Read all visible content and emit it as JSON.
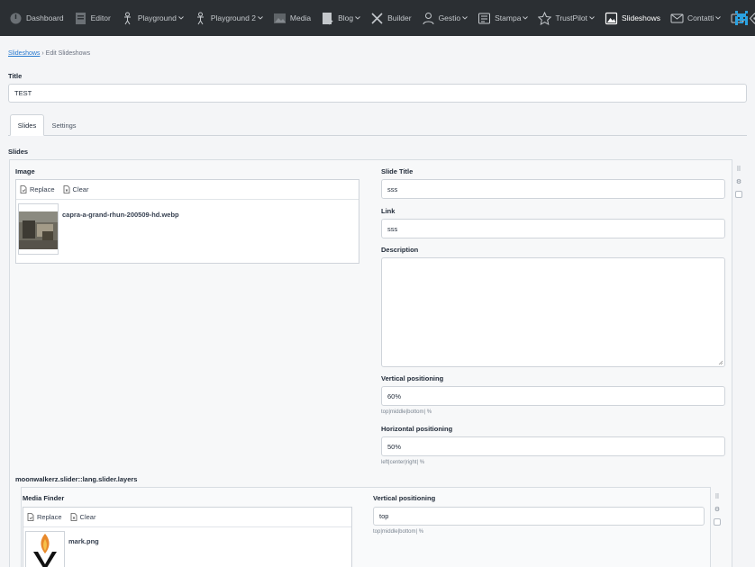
{
  "nav": {
    "items": [
      {
        "label": "Dashboard",
        "icon": "dashboard-icon",
        "has_menu": false
      },
      {
        "label": "Editor",
        "icon": "editor-icon",
        "has_menu": false
      },
      {
        "label": "Playground",
        "icon": "person-icon",
        "has_menu": true
      },
      {
        "label": "Playground 2",
        "icon": "person-icon",
        "has_menu": true
      },
      {
        "label": "Media",
        "icon": "media-icon",
        "has_menu": false
      },
      {
        "label": "Blog",
        "icon": "blog-icon",
        "has_menu": true
      },
      {
        "label": "Builder",
        "icon": "tools-icon",
        "has_menu": false
      },
      {
        "label": "Gestio",
        "icon": "user-icon",
        "has_menu": true
      },
      {
        "label": "Stampa",
        "icon": "newspaper-icon",
        "has_menu": true
      },
      {
        "label": "TrustPilot",
        "icon": "star-icon",
        "has_menu": true
      },
      {
        "label": "Slideshows",
        "icon": "image-icon",
        "has_menu": false,
        "active": true
      },
      {
        "label": "Contatti",
        "icon": "mail-icon",
        "has_menu": true
      }
    ]
  },
  "breadcrumb": {
    "parent": "Slideshows",
    "separator": "›",
    "current": "Edit Slideshows"
  },
  "form": {
    "title_label": "Title",
    "title_value": "TEST",
    "tabs": [
      "Slides",
      "Settings"
    ],
    "slides_label": "Slides"
  },
  "slide": {
    "image_label": "Image",
    "replace_label": "Replace",
    "clear_label": "Clear",
    "file_name": "capra-a-grand-rhun-200509-hd.webp",
    "slide_title_label": "Slide Title",
    "slide_title_value": "sss",
    "link_label": "Link",
    "link_value": "sss",
    "description_label": "Description",
    "description_value": "",
    "vertical_label": "Vertical positioning",
    "vertical_value": "60%",
    "vertical_hint": "top|middle|bottom| %",
    "horizontal_label": "Horizontal positioning",
    "horizontal_value": "50%",
    "horizontal_hint": "left|center|right| %",
    "layers_label": "moonwalkerz.slider::lang.slider.layers"
  },
  "layer": {
    "media_finder_label": "Media Finder",
    "replace_label": "Replace",
    "clear_label": "Clear",
    "file_name": "mark.png",
    "vertical_label": "Vertical positioning",
    "vertical_value": "top",
    "vertical_hint": "top|middle|bottom| %"
  },
  "colors": {
    "nav_bg": "#2b2f33",
    "link": "#2a7bd0",
    "logo": "#2aa1e0"
  }
}
